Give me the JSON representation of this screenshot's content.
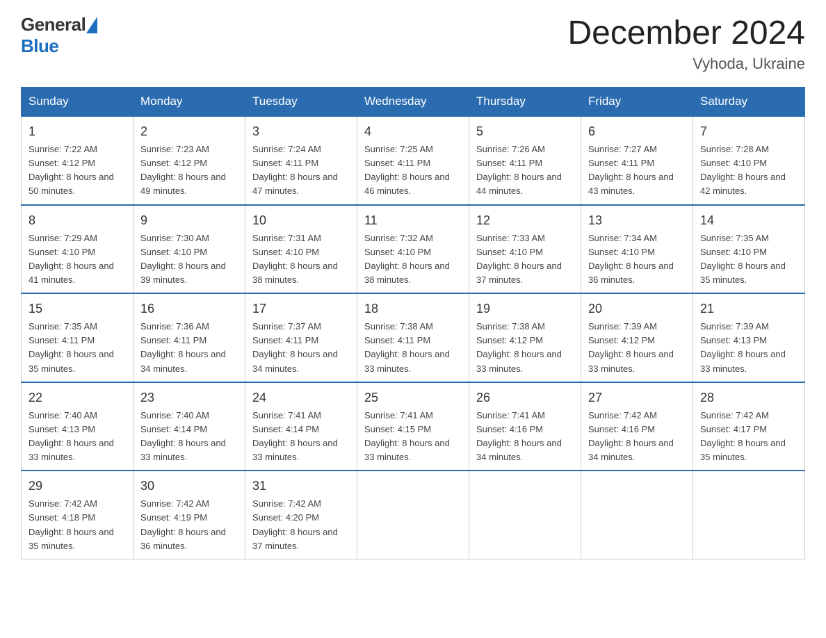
{
  "header": {
    "month_title": "December 2024",
    "location": "Vyhoda, Ukraine",
    "logo_general": "General",
    "logo_blue": "Blue"
  },
  "days_of_week": [
    "Sunday",
    "Monday",
    "Tuesday",
    "Wednesday",
    "Thursday",
    "Friday",
    "Saturday"
  ],
  "weeks": [
    [
      {
        "day": "1",
        "sunrise": "7:22 AM",
        "sunset": "4:12 PM",
        "daylight": "8 hours and 50 minutes."
      },
      {
        "day": "2",
        "sunrise": "7:23 AM",
        "sunset": "4:12 PM",
        "daylight": "8 hours and 49 minutes."
      },
      {
        "day": "3",
        "sunrise": "7:24 AM",
        "sunset": "4:11 PM",
        "daylight": "8 hours and 47 minutes."
      },
      {
        "day": "4",
        "sunrise": "7:25 AM",
        "sunset": "4:11 PM",
        "daylight": "8 hours and 46 minutes."
      },
      {
        "day": "5",
        "sunrise": "7:26 AM",
        "sunset": "4:11 PM",
        "daylight": "8 hours and 44 minutes."
      },
      {
        "day": "6",
        "sunrise": "7:27 AM",
        "sunset": "4:11 PM",
        "daylight": "8 hours and 43 minutes."
      },
      {
        "day": "7",
        "sunrise": "7:28 AM",
        "sunset": "4:10 PM",
        "daylight": "8 hours and 42 minutes."
      }
    ],
    [
      {
        "day": "8",
        "sunrise": "7:29 AM",
        "sunset": "4:10 PM",
        "daylight": "8 hours and 41 minutes."
      },
      {
        "day": "9",
        "sunrise": "7:30 AM",
        "sunset": "4:10 PM",
        "daylight": "8 hours and 39 minutes."
      },
      {
        "day": "10",
        "sunrise": "7:31 AM",
        "sunset": "4:10 PM",
        "daylight": "8 hours and 38 minutes."
      },
      {
        "day": "11",
        "sunrise": "7:32 AM",
        "sunset": "4:10 PM",
        "daylight": "8 hours and 38 minutes."
      },
      {
        "day": "12",
        "sunrise": "7:33 AM",
        "sunset": "4:10 PM",
        "daylight": "8 hours and 37 minutes."
      },
      {
        "day": "13",
        "sunrise": "7:34 AM",
        "sunset": "4:10 PM",
        "daylight": "8 hours and 36 minutes."
      },
      {
        "day": "14",
        "sunrise": "7:35 AM",
        "sunset": "4:10 PM",
        "daylight": "8 hours and 35 minutes."
      }
    ],
    [
      {
        "day": "15",
        "sunrise": "7:35 AM",
        "sunset": "4:11 PM",
        "daylight": "8 hours and 35 minutes."
      },
      {
        "day": "16",
        "sunrise": "7:36 AM",
        "sunset": "4:11 PM",
        "daylight": "8 hours and 34 minutes."
      },
      {
        "day": "17",
        "sunrise": "7:37 AM",
        "sunset": "4:11 PM",
        "daylight": "8 hours and 34 minutes."
      },
      {
        "day": "18",
        "sunrise": "7:38 AM",
        "sunset": "4:11 PM",
        "daylight": "8 hours and 33 minutes."
      },
      {
        "day": "19",
        "sunrise": "7:38 AM",
        "sunset": "4:12 PM",
        "daylight": "8 hours and 33 minutes."
      },
      {
        "day": "20",
        "sunrise": "7:39 AM",
        "sunset": "4:12 PM",
        "daylight": "8 hours and 33 minutes."
      },
      {
        "day": "21",
        "sunrise": "7:39 AM",
        "sunset": "4:13 PM",
        "daylight": "8 hours and 33 minutes."
      }
    ],
    [
      {
        "day": "22",
        "sunrise": "7:40 AM",
        "sunset": "4:13 PM",
        "daylight": "8 hours and 33 minutes."
      },
      {
        "day": "23",
        "sunrise": "7:40 AM",
        "sunset": "4:14 PM",
        "daylight": "8 hours and 33 minutes."
      },
      {
        "day": "24",
        "sunrise": "7:41 AM",
        "sunset": "4:14 PM",
        "daylight": "8 hours and 33 minutes."
      },
      {
        "day": "25",
        "sunrise": "7:41 AM",
        "sunset": "4:15 PM",
        "daylight": "8 hours and 33 minutes."
      },
      {
        "day": "26",
        "sunrise": "7:41 AM",
        "sunset": "4:16 PM",
        "daylight": "8 hours and 34 minutes."
      },
      {
        "day": "27",
        "sunrise": "7:42 AM",
        "sunset": "4:16 PM",
        "daylight": "8 hours and 34 minutes."
      },
      {
        "day": "28",
        "sunrise": "7:42 AM",
        "sunset": "4:17 PM",
        "daylight": "8 hours and 35 minutes."
      }
    ],
    [
      {
        "day": "29",
        "sunrise": "7:42 AM",
        "sunset": "4:18 PM",
        "daylight": "8 hours and 35 minutes."
      },
      {
        "day": "30",
        "sunrise": "7:42 AM",
        "sunset": "4:19 PM",
        "daylight": "8 hours and 36 minutes."
      },
      {
        "day": "31",
        "sunrise": "7:42 AM",
        "sunset": "4:20 PM",
        "daylight": "8 hours and 37 minutes."
      },
      null,
      null,
      null,
      null
    ]
  ]
}
